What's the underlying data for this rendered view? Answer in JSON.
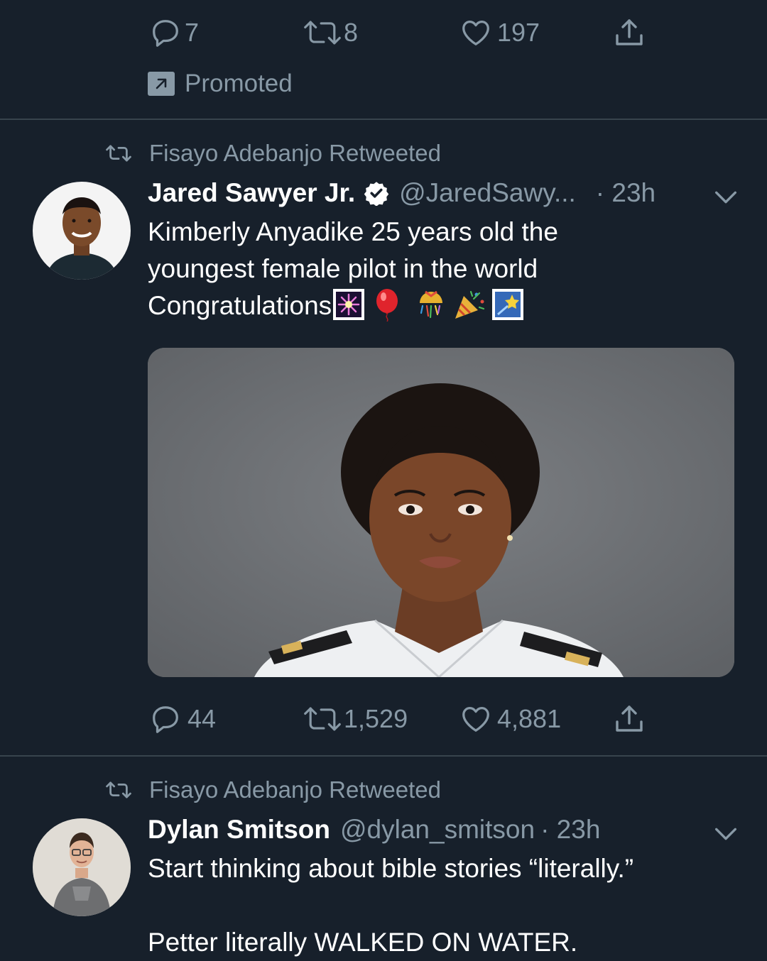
{
  "top_tweet": {
    "actions": {
      "reply_count": "7",
      "retweet_count": "8",
      "like_count": "197"
    },
    "promoted_label": "Promoted"
  },
  "tweet1": {
    "retweeted_by": "Fisayo Adebanjo Retweeted",
    "author_name": "Jared Sawyer Jr.",
    "verified": true,
    "handle": "@JaredSawy...",
    "time": "· 23h",
    "text_line1": "Kimberly Anyadike 25 years old the",
    "text_line2": "youngest female pilot in the world",
    "text_line3": "Congratulations",
    "emojis": [
      "fireworks-emoji",
      "balloon-emoji",
      "confetti-ball-emoji",
      "party-popper-emoji",
      "shooting-star-emoji"
    ],
    "actions": {
      "reply_count": "44",
      "retweet_count": "1,529",
      "like_count": "4,881"
    }
  },
  "tweet2": {
    "retweeted_by": "Fisayo Adebanjo Retweeted",
    "author_name": "Dylan Smitson",
    "handle": "@dylan_smitson",
    "time": "· 23h",
    "text_line1": "Start thinking about bible stories “literally.”",
    "text_line2": "Petter literally WALKED ON WATER."
  },
  "colors": {
    "background": "#17202b",
    "muted_text": "#8899a6",
    "divider": "#38444d",
    "text": "#ffffff"
  }
}
